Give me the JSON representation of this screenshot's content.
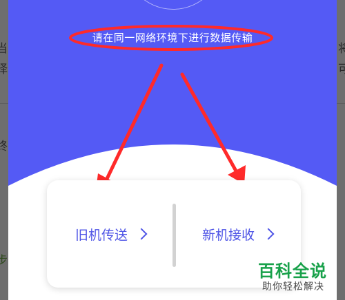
{
  "hint_text": "请在同一网络环境下进行数据传输",
  "options": {
    "send_label": "旧机传送",
    "receive_label": "新机接收"
  },
  "background_fragments": [
    "当",
    "择",
    "终",
    "步",
    "将",
    "可"
  ],
  "watermark": {
    "title": "百科全说",
    "subtitle": "助你轻松解决"
  },
  "colors": {
    "panel": "#545af5",
    "accent_text": "#4f55e6",
    "annotation": "#ff2a2a",
    "watermark_green": "#18a14a"
  }
}
